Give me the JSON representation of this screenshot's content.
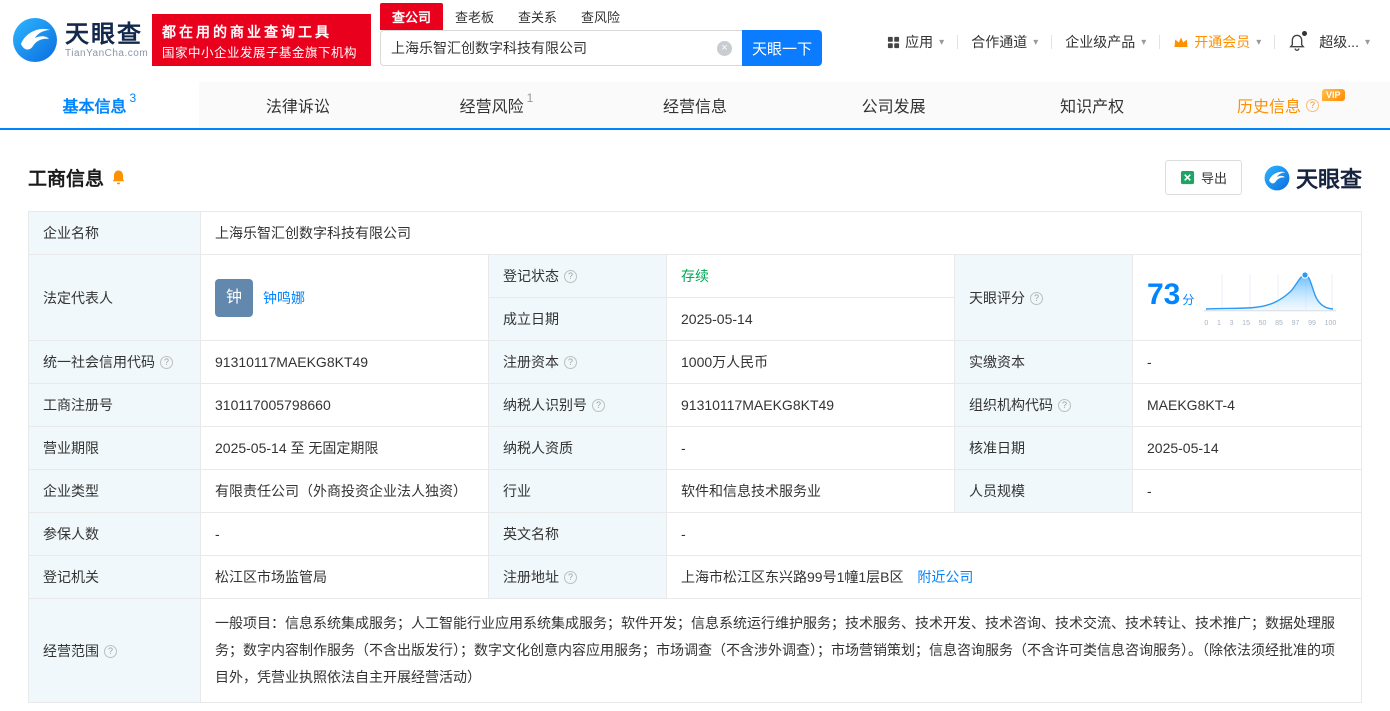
{
  "brand": {
    "name": "天眼查",
    "domain": "TianYanCha.com",
    "accent_blue": "#0084ff",
    "brand_red": "#e8001c",
    "vip_orange": "#ff9000",
    "status_green": "#00a854"
  },
  "header": {
    "slogan_line1": "都在用的商业查询工具",
    "slogan_line2": "国家中小企业发展子基金旗下机构",
    "search_tabs": [
      {
        "label": "查公司"
      },
      {
        "label": "查老板"
      },
      {
        "label": "查关系"
      },
      {
        "label": "查风险"
      }
    ],
    "search_value": "上海乐智汇创数字科技有限公司",
    "search_button": "天眼一下",
    "nav": [
      {
        "label": "应用"
      },
      {
        "label": "合作通道"
      },
      {
        "label": "企业级产品"
      },
      {
        "label": "开通会员"
      },
      {
        "label": "超级..."
      }
    ]
  },
  "page_tabs": [
    {
      "label": "基本信息",
      "badge": "3"
    },
    {
      "label": "法律诉讼"
    },
    {
      "label": "经营风险",
      "badge": "1"
    },
    {
      "label": "经营信息"
    },
    {
      "label": "公司发展"
    },
    {
      "label": "知识产权"
    },
    {
      "label": "历史信息",
      "vip_tag": "VIP"
    }
  ],
  "section": {
    "title": "工商信息",
    "export_label": "导出",
    "watermark": "天眼查"
  },
  "fields": {
    "company_name": {
      "label": "企业名称",
      "value": "上海乐智汇创数字科技有限公司"
    },
    "legal_rep": {
      "label": "法定代表人",
      "avatar": "钟",
      "value": "钟鸣娜"
    },
    "reg_status": {
      "label": "登记状态",
      "value": "存续"
    },
    "establish_date": {
      "label": "成立日期",
      "value": "2025-05-14"
    },
    "score": {
      "label": "天眼评分",
      "value": "73",
      "unit": "分"
    },
    "credit_code": {
      "label": "统一社会信用代码",
      "value": "91310117MAEKG8KT49"
    },
    "reg_capital": {
      "label": "注册资本",
      "value": "1000万人民币"
    },
    "paid_capital": {
      "label": "实缴资本",
      "value": "-"
    },
    "reg_number": {
      "label": "工商注册号",
      "value": "310117005798660"
    },
    "taxpayer_id": {
      "label": "纳税人识别号",
      "value": "91310117MAEKG8KT49"
    },
    "org_code": {
      "label": "组织机构代码",
      "value": "MAEKG8KT-4"
    },
    "business_term": {
      "label": "营业期限",
      "value": "2025-05-14 至 无固定期限"
    },
    "taxpayer_quality": {
      "label": "纳税人资质",
      "value": "-"
    },
    "approval_date": {
      "label": "核准日期",
      "value": "2025-05-14"
    },
    "company_type": {
      "label": "企业类型",
      "value": "有限责任公司（外商投资企业法人独资）"
    },
    "industry": {
      "label": "行业",
      "value": "软件和信息技术服务业"
    },
    "staff_size": {
      "label": "人员规模",
      "value": "-"
    },
    "insured_count": {
      "label": "参保人数",
      "value": "-"
    },
    "english_name": {
      "label": "英文名称",
      "value": "-"
    },
    "reg_authority": {
      "label": "登记机关",
      "value": "松江区市场监管局"
    },
    "reg_address": {
      "label": "注册地址",
      "value": "上海市松江区东兴路99号1幢1层B区",
      "nearby_link": "附近公司"
    },
    "business_scope": {
      "label": "经营范围",
      "value": "一般项目：信息系统集成服务；人工智能行业应用系统集成服务；软件开发；信息系统运行维护服务；技术服务、技术开发、技术咨询、技术交流、技术转让、技术推广；数据处理服务；数字内容制作服务（不含出版发行）；数字文化创意内容应用服务；市场调查（不含涉外调查）；市场营销策划；信息咨询服务（不含许可类信息咨询服务）。（除依法须经批准的项目外，凭营业执照依法自主开展经营活动）"
    }
  },
  "score_chart": {
    "type": "area",
    "score": 73,
    "x_ticks": [
      "0",
      "1",
      "3",
      "15",
      "50",
      "85",
      "97",
      "99",
      "100"
    ]
  }
}
